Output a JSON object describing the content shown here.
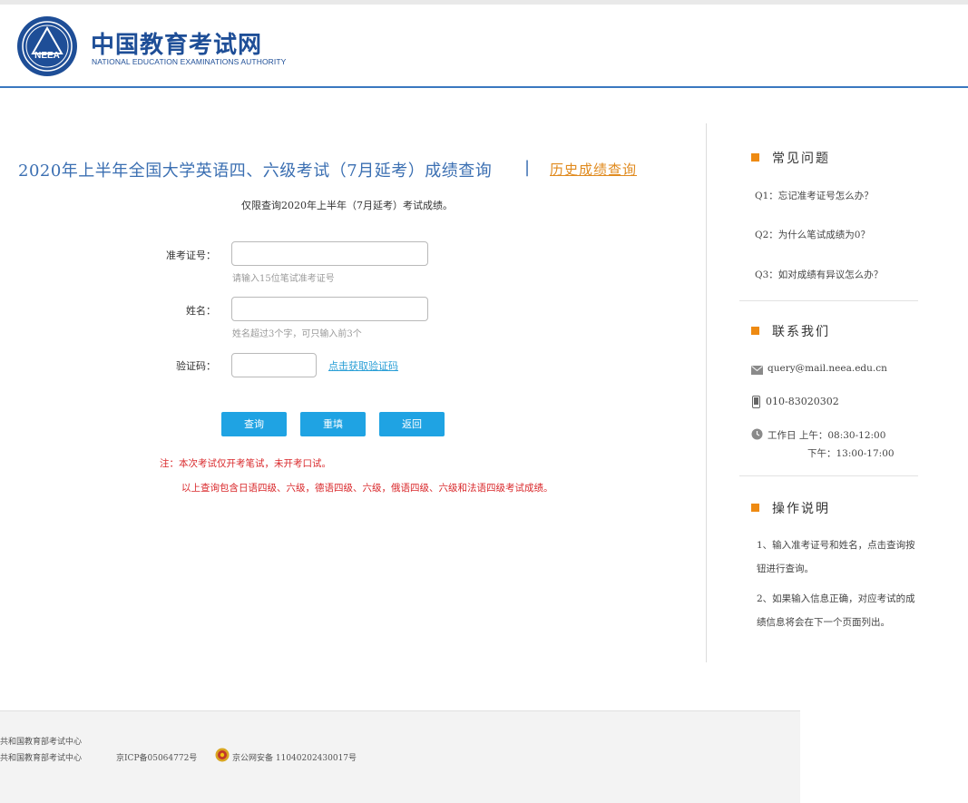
{
  "header": {
    "site_name_cn": "中国教育考试网",
    "site_name_en": "NATIONAL EDUCATION EXAMINATIONS AUTHORITY",
    "emblem_text": "NEEA"
  },
  "main": {
    "title": "2020年上半年全国大学英语四、六级考试（7月延考）成绩查询",
    "separator": "|",
    "history_link": "历史成绩查询",
    "subtitle": "仅限查询2020年上半年（7月延考）考试成绩。",
    "form": {
      "ticket_label": "准考证号：",
      "ticket_value": "",
      "ticket_hint": "请输入15位笔试准考证号",
      "name_label": "姓名：",
      "name_value": "",
      "name_hint": "姓名超过3个字，可只输入前3个",
      "captcha_label": "验证码：",
      "captcha_value": "",
      "captcha_link": "点击获取验证码"
    },
    "buttons": {
      "query": "查询",
      "reset": "重填",
      "back": "返回"
    },
    "notes": {
      "note1": "注：本次考试仅开考笔试，未开考口试。",
      "note2": "以上查询包含日语四级、六级，德语四级、六级，俄语四级、六级和法语四级考试成绩。"
    }
  },
  "sidebar": {
    "faq_title": "常见问题",
    "faq": [
      "Q1：忘记准考证号怎么办？",
      "Q2：为什么笔试成绩为0？",
      "Q3：如对成绩有异议怎么办？"
    ],
    "contact_title": "联系我们",
    "email": "query@mail.neea.edu.cn",
    "phone": "010-83020302",
    "hours_line1": "工作日  上午：08:30-12:00",
    "hours_line2": "下午：13:00-17:00",
    "guide_title": "操作说明",
    "guide1": "1、输入准考证号和姓名，点击查询按钮进行查询。",
    "guide2": "2、如果输入信息正确，对应考试的成绩信息将会在下一个页面列出。"
  },
  "footer": {
    "line1": "共和国教育部考试中心",
    "line2": "共和国教育部考试中心",
    "icp": "京ICP备05064772号",
    "police": "京公网安备 11040202430017号"
  },
  "colors": {
    "brand_blue": "#1e4e97",
    "title_blue": "#3b6fb2",
    "button_blue": "#1fa3e3",
    "link_orange": "#e08a1e",
    "note_red": "#d9282b",
    "section_square": "#ee8a12"
  }
}
